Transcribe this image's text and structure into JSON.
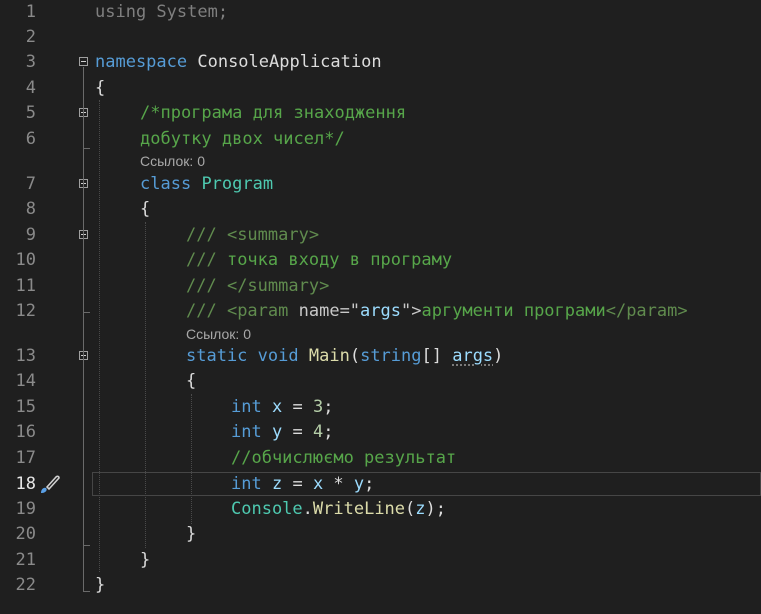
{
  "active_line": "18",
  "line_numbers": [
    "1",
    "2",
    "3",
    "4",
    "5",
    "6",
    "7",
    "8",
    "9",
    "10",
    "11",
    "12",
    "13",
    "14",
    "15",
    "16",
    "17",
    "18",
    "19",
    "20",
    "21",
    "22"
  ],
  "code_lens": {
    "program_refs": "Ссылок: 0",
    "main_refs": "Ссылок: 0"
  },
  "code": {
    "l1": {
      "kw": "using",
      "rest": " System;"
    },
    "l3": {
      "kw": "namespace",
      "name": " ConsoleApplication"
    },
    "l4": "{",
    "l5": "/*програма для знаходження",
    "l6": "добутку двох чисел*/",
    "l7": {
      "kw": "class",
      "name": "Program"
    },
    "l8": "{",
    "l9": {
      "prefix": "/// ",
      "tag": "<summary>"
    },
    "l10": {
      "prefix": "/// ",
      "text": "точка входу в програму"
    },
    "l11": {
      "prefix": "/// ",
      "tag": "</summary>"
    },
    "l12": {
      "prefix": "/// ",
      "open": "<param ",
      "attr": "name",
      "eq": "=\"",
      "val": "args",
      "close_q": "\">",
      "text": "аргументи програми",
      "end": "</param>"
    },
    "l13": {
      "kw1": "static",
      "kw2": "void",
      "fn": "Main",
      "paren": "(",
      "type": "string",
      "brk": "[] ",
      "arg": "args",
      "end": ")"
    },
    "l14": "{",
    "l15": {
      "kw": "int",
      "var": "x",
      "op": " = ",
      "num": "3",
      "semi": ";"
    },
    "l16": {
      "kw": "int",
      "var": "y",
      "op": " = ",
      "num": "4",
      "semi": ";"
    },
    "l17": "//обчислюємо результат",
    "l18": {
      "kw": "int",
      "var": "z",
      "op": " = ",
      "v1": "x",
      "mul": " * ",
      "v2": "y",
      "semi": ";"
    },
    "l19": {
      "cls": "Console",
      "dot": ".",
      "fn": "WriteLine",
      "open": "(",
      "arg": "z",
      "close": ");"
    },
    "l20": "}",
    "l21": "}",
    "l22": "}"
  },
  "icons": {
    "gutter_action": "paintbrush-icon"
  }
}
